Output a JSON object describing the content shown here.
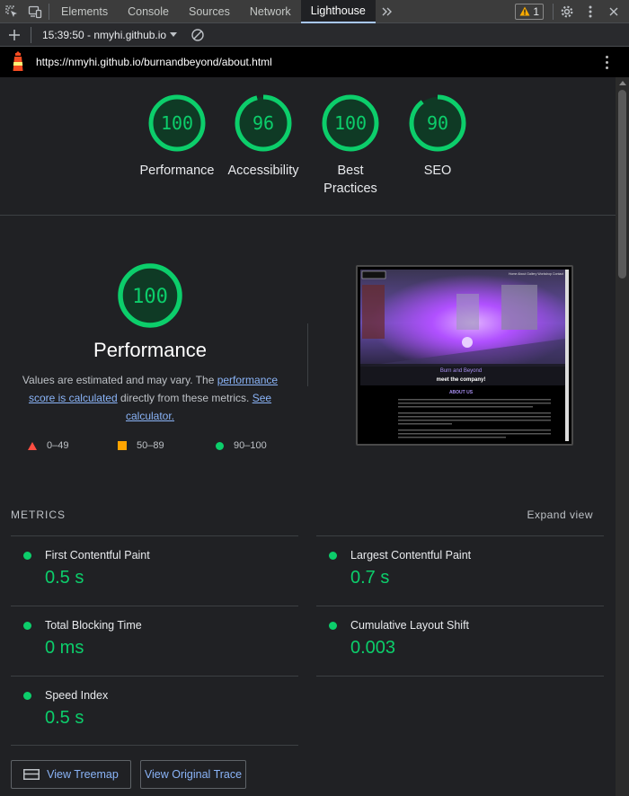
{
  "devtools": {
    "tabs": [
      {
        "label": "Elements"
      },
      {
        "label": "Console"
      },
      {
        "label": "Sources"
      },
      {
        "label": "Network"
      },
      {
        "label": "Lighthouse"
      }
    ],
    "warning_count": "1"
  },
  "toolbar": {
    "report_label": "15:39:50 - nmyhi.github.io"
  },
  "url": "https://nmyhi.github.io/burnandbeyond/about.html",
  "scores": [
    {
      "label": "Performance",
      "value": "100",
      "score": 100
    },
    {
      "label": "Accessibility",
      "value": "96",
      "score": 96
    },
    {
      "label": "Best Practices",
      "value": "100",
      "score": 100
    },
    {
      "label": "SEO",
      "value": "90",
      "score": 90
    }
  ],
  "performance": {
    "score": "100",
    "title": "Performance",
    "desc_prefix": "Values are estimated and may vary. The ",
    "link1": "performance score is calculated",
    "desc_middle": " directly from these metrics. ",
    "link2": "See calculator."
  },
  "legend": [
    {
      "range": "0–49",
      "color": "#ff4e42"
    },
    {
      "range": "50–89",
      "color": "#ffa400"
    },
    {
      "range": "90–100",
      "color": "#0cce6b"
    }
  ],
  "screenshot": {
    "nav": [
      "Home",
      "About",
      "Gallery",
      "Workshop",
      "Contact"
    ],
    "title": "Burn and Beyond",
    "subtitle": "meet the company!",
    "section": "ABOUT US"
  },
  "metrics": {
    "heading": "METRICS",
    "expand_label": "Expand view",
    "items": [
      {
        "name": "First Contentful Paint",
        "value": "0.5 s"
      },
      {
        "name": "Largest Contentful Paint",
        "value": "0.7 s"
      },
      {
        "name": "Total Blocking Time",
        "value": "0 ms"
      },
      {
        "name": "Cumulative Layout Shift",
        "value": "0.003"
      },
      {
        "name": "Speed Index",
        "value": "0.5 s"
      }
    ]
  },
  "buttons": {
    "treemap": "View Treemap",
    "trace": "View Original Trace"
  },
  "colors": {
    "pass": "#0cce6b",
    "link": "#8ab4f8"
  }
}
